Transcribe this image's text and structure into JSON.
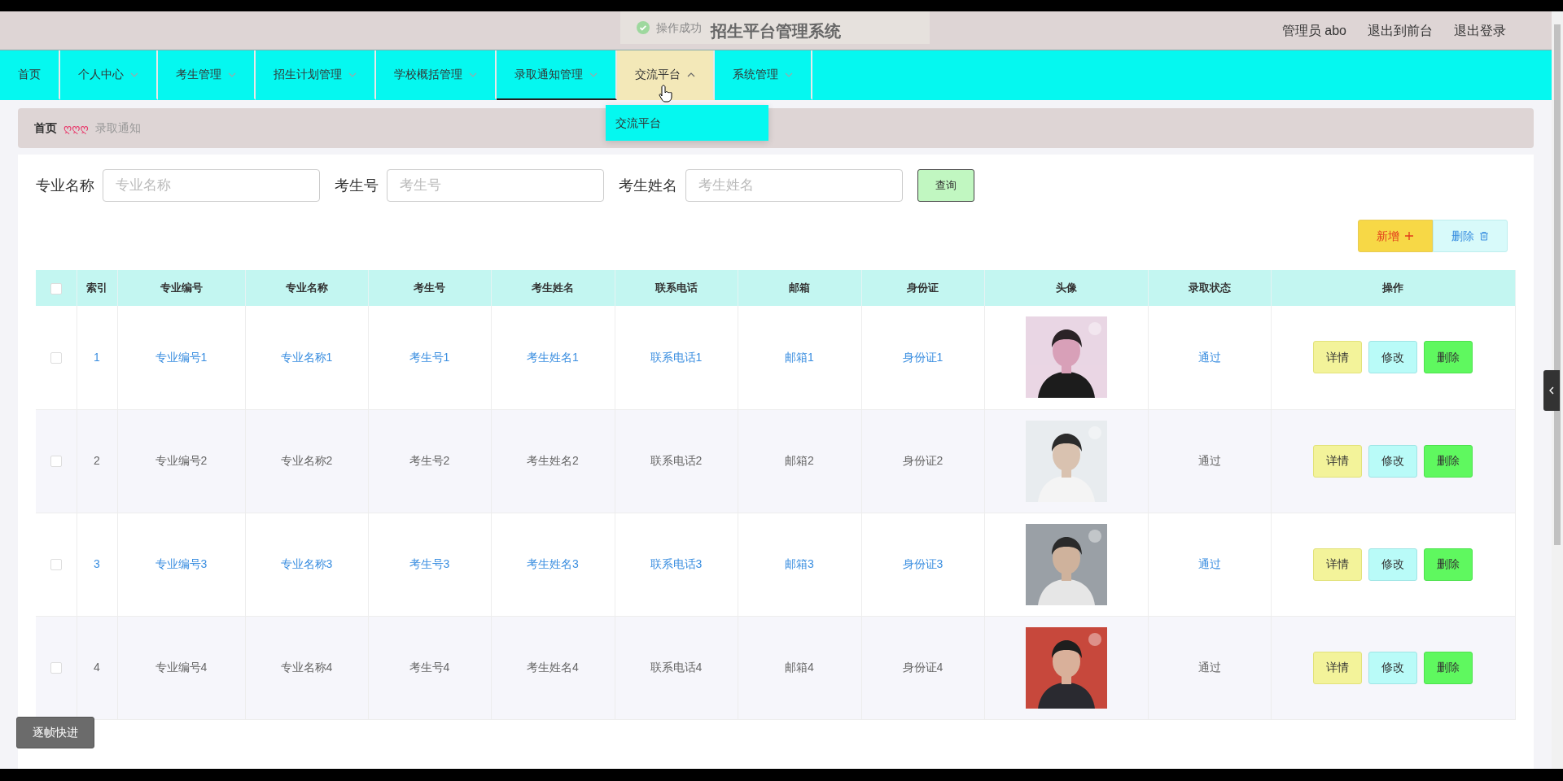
{
  "header": {
    "title": "招生平台管理系统",
    "toast": {
      "text": "操作成功"
    },
    "user_links": [
      "管理员 abo",
      "退出到前台",
      "退出登录"
    ]
  },
  "nav": [
    {
      "label": "首页",
      "kind": "link",
      "selected": false,
      "expanded": false
    },
    {
      "label": "个人中心",
      "kind": "menu",
      "selected": false,
      "expanded": false
    },
    {
      "label": "考生管理",
      "kind": "menu",
      "selected": false,
      "expanded": false
    },
    {
      "label": "招生计划管理",
      "kind": "menu",
      "selected": false,
      "expanded": false
    },
    {
      "label": "学校概括管理",
      "kind": "menu",
      "selected": false,
      "expanded": false
    },
    {
      "label": "录取通知管理",
      "kind": "menu",
      "selected": true,
      "expanded": false
    },
    {
      "label": "交流平台",
      "kind": "menu",
      "selected": false,
      "expanded": true,
      "items": [
        "交流平台"
      ]
    },
    {
      "label": "系统管理",
      "kind": "menu",
      "selected": false,
      "expanded": false
    }
  ],
  "breadcrumb": {
    "home": "首页",
    "separator": "ღღღ",
    "current": "录取通知"
  },
  "search": {
    "fields": [
      {
        "label": "专业名称",
        "placeholder": "专业名称"
      },
      {
        "label": "考生号",
        "placeholder": "考生号"
      },
      {
        "label": "考生姓名",
        "placeholder": "考生姓名"
      }
    ],
    "button": "查询"
  },
  "toolbar": {
    "add": "新增",
    "delete": "删除"
  },
  "table": {
    "select_all": {
      "checked": false
    },
    "columns": [
      "索引",
      "专业编号",
      "专业名称",
      "考生号",
      "考生姓名",
      "联系电话",
      "邮箱",
      "身份证",
      "头像",
      "录取状态",
      "操作"
    ],
    "rows": [
      {
        "checked": false,
        "highlighted": true,
        "cells": [
          "1",
          "专业编号1",
          "专业名称1",
          "考生号1",
          "考生姓名1",
          "联系电话1",
          "邮箱1",
          "身份证1"
        ],
        "avatar": {
          "kind": "picture"
        },
        "status": "通过",
        "actions": [
          "详情",
          "修改",
          "删除"
        ]
      },
      {
        "checked": false,
        "highlighted": false,
        "cells": [
          "2",
          "专业编号2",
          "专业名称2",
          "考生号2",
          "考生姓名2",
          "联系电话2",
          "邮箱2",
          "身份证2"
        ],
        "avatar": {
          "kind": "picture"
        },
        "status": "通过",
        "actions": [
          "详情",
          "修改",
          "删除"
        ]
      },
      {
        "checked": false,
        "highlighted": true,
        "cells": [
          "3",
          "专业编号3",
          "专业名称3",
          "考生号3",
          "考生姓名3",
          "联系电话3",
          "邮箱3",
          "身份证3"
        ],
        "avatar": {
          "kind": "picture"
        },
        "status": "通过",
        "actions": [
          "详情",
          "修改",
          "删除"
        ]
      },
      {
        "checked": false,
        "highlighted": false,
        "cells": [
          "4",
          "专业编号4",
          "专业名称4",
          "考生号4",
          "考生姓名4",
          "联系电话4",
          "邮箱4",
          "身份证4"
        ],
        "avatar": {
          "kind": "picture"
        },
        "status": "通过",
        "actions": [
          "详情",
          "修改",
          "删除"
        ]
      }
    ]
  },
  "player": {
    "button": "逐帧快进"
  }
}
